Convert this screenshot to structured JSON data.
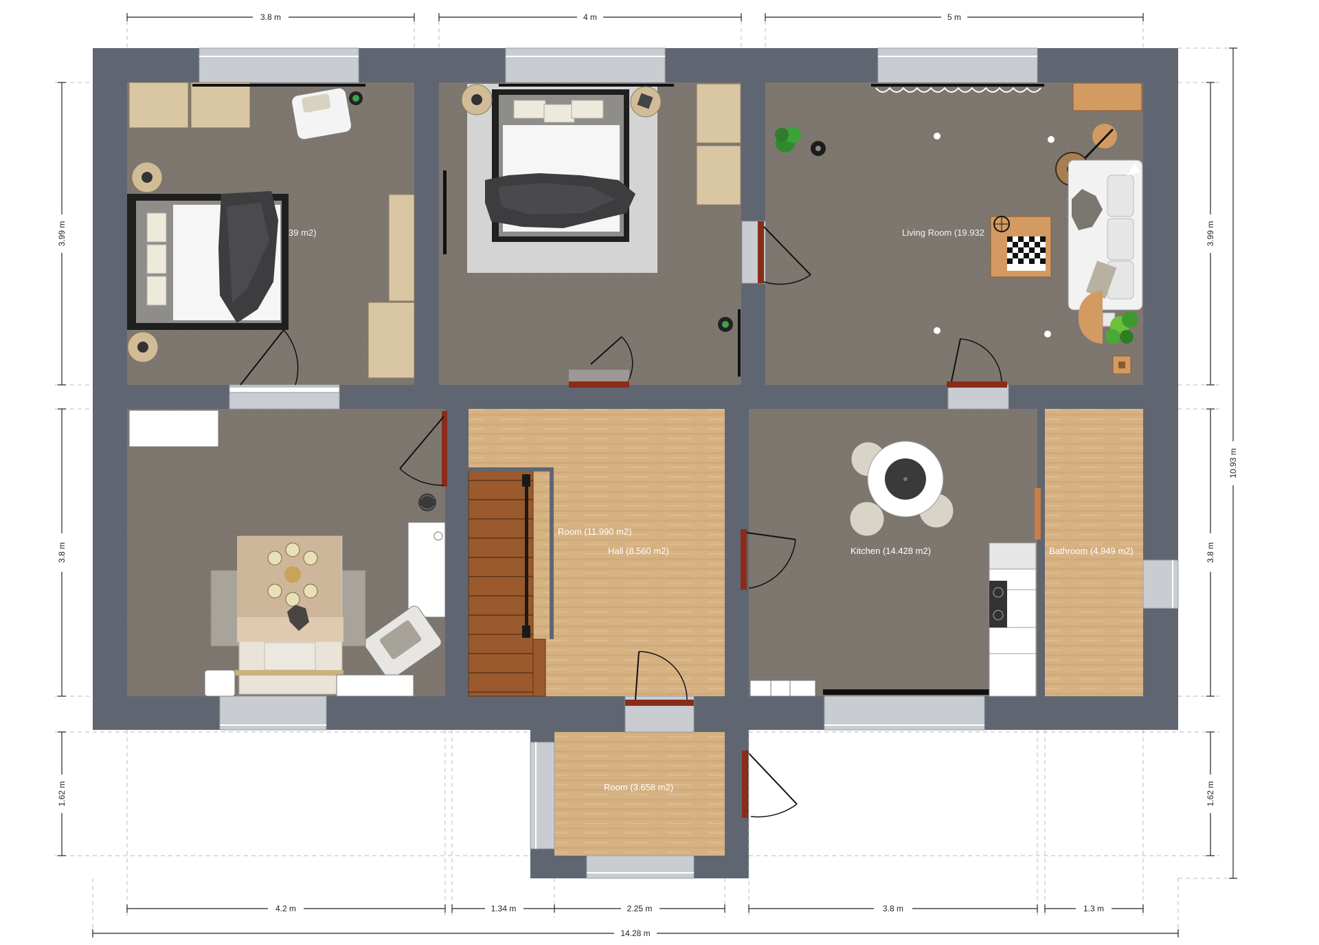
{
  "colors": {
    "wall": "#5f6671",
    "carpet": "#7d766f",
    "wood": "#d2ac7b",
    "window": "#c9ccd1",
    "door_leaf": "#8a2c1a",
    "stair": "#9a5a2d",
    "furniture": "#d9c6a3",
    "dim_line": "#222222"
  },
  "rooms": [
    {
      "id": "bedroom1",
      "label": "39 m2)",
      "floor": "carpet"
    },
    {
      "id": "bedroom2",
      "label": "",
      "floor": "carpet"
    },
    {
      "id": "living",
      "label": "Living Room (19.932",
      "floor": "carpet"
    },
    {
      "id": "bedroom3",
      "label": "",
      "floor": "carpet"
    },
    {
      "id": "room_hall",
      "label": "Room (11.990 m2)",
      "floor": "wood"
    },
    {
      "id": "hall",
      "label": "Hall (8.560 m2)",
      "floor": "wood"
    },
    {
      "id": "kitchen",
      "label": "Kitchen (14.428 m2)",
      "floor": "carpet"
    },
    {
      "id": "bathroom",
      "label": "Bathroom (4.949 m2)",
      "floor": "wood"
    },
    {
      "id": "entry",
      "label": "Room (3.658 m2)",
      "floor": "wood"
    }
  ],
  "dimensions": {
    "top": [
      "3.8 m",
      "4 m",
      "5 m"
    ],
    "bottom": [
      "4.2 m",
      "1.34 m",
      "2.25 m",
      "3.8 m",
      "1.3 m"
    ],
    "total_width": "14.28 m",
    "left": [
      "3.99 m",
      "3.8 m",
      "1.62 m"
    ],
    "right": [
      "3.99 m",
      "3.8 m",
      "1.62 m"
    ],
    "total_height": "10.93 m"
  },
  "icons": {
    "bed": "bed-icon",
    "sofa": "sofa-icon",
    "plant": "plant-icon",
    "lamp": "lamp-icon",
    "table": "table-icon",
    "stairs": "stairs-icon",
    "door": "door-icon",
    "window": "window-icon"
  }
}
